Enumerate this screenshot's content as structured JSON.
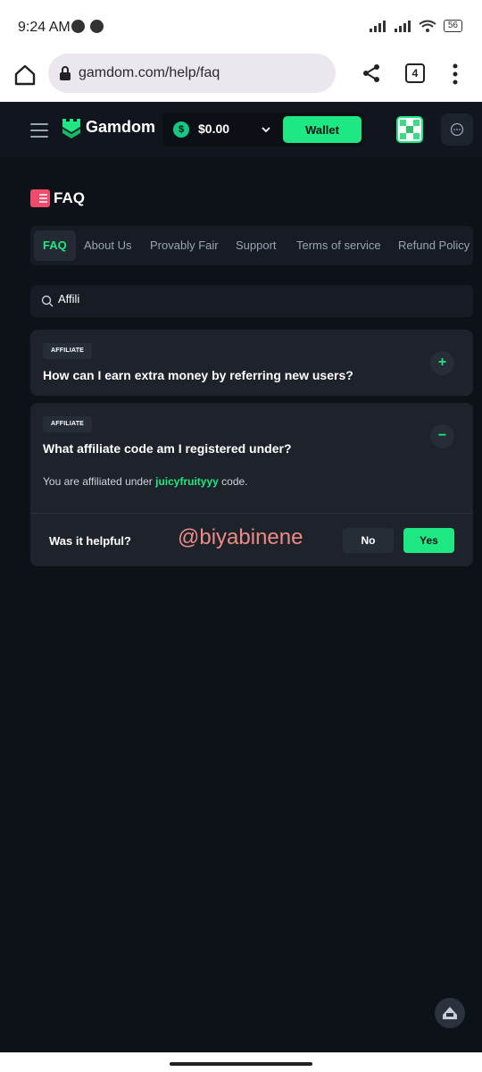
{
  "status_bar": {
    "time": "9:24 AM",
    "battery": "56"
  },
  "browser": {
    "url": "gamdom.com/help/faq",
    "tab_count": "4"
  },
  "header": {
    "logo_text": "Gamdom",
    "balance": "$0.00",
    "coin_symbol": "$",
    "wallet_label": "Wallet"
  },
  "page": {
    "title": "FAQ"
  },
  "tabs": [
    {
      "label": "FAQ",
      "active": true
    },
    {
      "label": "About Us",
      "active": false
    },
    {
      "label": "Provably Fair",
      "active": false
    },
    {
      "label": "Support",
      "active": false
    },
    {
      "label": "Terms of service",
      "active": false
    },
    {
      "label": "Refund Policy",
      "active": false
    }
  ],
  "search": {
    "value": "Affili"
  },
  "faq_items": [
    {
      "tag": "AFFILIATE",
      "question": "How can I earn extra money by referring new users?",
      "toggle": "+",
      "expanded": false
    },
    {
      "tag": "AFFILIATE",
      "question": "What affiliate code am I registered under?",
      "toggle": "−",
      "expanded": true,
      "answer_prefix": "You are affiliated under ",
      "answer_code": "juicyfruityyy",
      "answer_suffix": " code."
    }
  ],
  "feedback": {
    "question": "Was it helpful?",
    "no_label": "No",
    "yes_label": "Yes"
  },
  "watermark": "@biyabinene",
  "colors": {
    "accent": "#1ee883",
    "background": "#0d1118",
    "card": "#1d222b"
  }
}
